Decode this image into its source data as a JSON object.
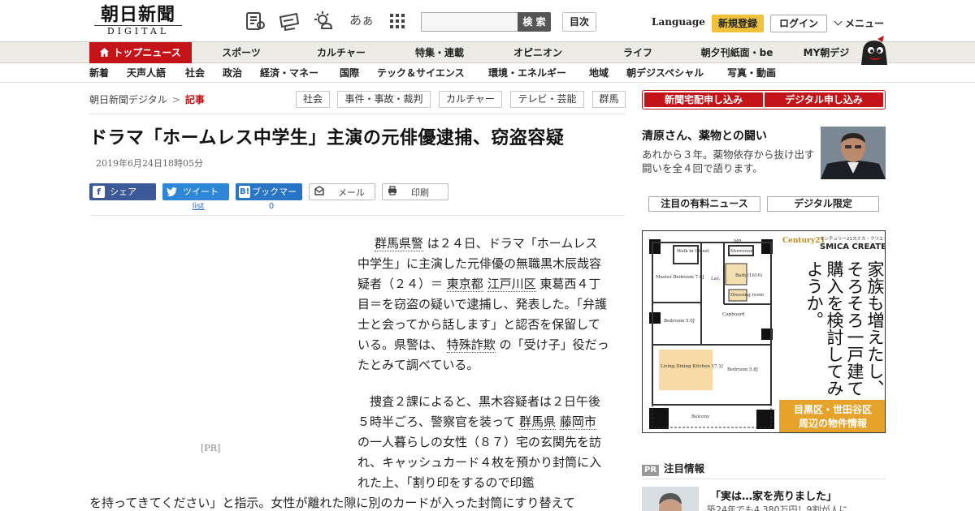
{
  "header": {
    "logo_main": "朝日新聞",
    "logo_sub": "DIGITAL",
    "search_button": "検 索",
    "search_placeholder": "",
    "toc_button": "目次",
    "language": "Language",
    "register_button": "新規登録",
    "login_button": "ログイン",
    "menu_button": "メニュー",
    "icons": [
      "newspaper-icon",
      "coupon-icon",
      "weather-icon",
      "font-size-icon",
      "grid-menu-icon"
    ],
    "font_size_glyph": "あぁ"
  },
  "nav_primary": [
    "トップニュース",
    "スポーツ",
    "カルチャー",
    "特集・連載",
    "オピニオン",
    "ライフ",
    "朝夕刊紙面・be",
    "MY朝デジ"
  ],
  "nav_secondary": [
    "新着",
    "天声人語",
    "社会",
    "政治",
    "経済・マネー",
    "国際",
    "テック＆サイエンス",
    "環境・エネルギー",
    "地域",
    "朝デジスペシャル",
    "写真・動画"
  ],
  "breadcrumb": {
    "home": "朝日新聞デジタル",
    "separator": ">",
    "current": "記事"
  },
  "tags": [
    "社会",
    "事件・事故・裁判",
    "カルチャー",
    "テレビ・芸能",
    "群馬"
  ],
  "article": {
    "headline": "ドラマ「ホームレス中学生」主演の元俳優逮捕、窃盗容疑",
    "date": "2019年6月24日18時05分",
    "share": {
      "facebook": "シェア",
      "twitter": "ツイート",
      "hatena": "ブックマーク",
      "mail": "メール",
      "print": "印刷",
      "twitter_count": "list",
      "hatena_count": "0"
    },
    "ad_label": "[PR]",
    "p1": [
      {
        "t": "群馬県警",
        "kw": true
      },
      {
        "t": " は２４日、ドラマ「ホームレス中学生」に主演した元俳優の無職黒木辰哉容疑者（２４）＝ ",
        "kw": false
      },
      {
        "t": "東京都",
        "kw": true
      },
      {
        "t": " ",
        "kw": false
      },
      {
        "t": "江戸川区",
        "kw": true
      },
      {
        "t": " 東葛西４丁目＝を窃盗の疑いで逮捕し、発表した。「弁護士と会ってから話します」と認否を保留している。県警は、 ",
        "kw": false
      },
      {
        "t": "特殊詐欺",
        "kw": true
      },
      {
        "t": " の「受け子」役だったとみて調べている。",
        "kw": false
      }
    ],
    "p2": [
      {
        "t": "捜査２課によると、黒木容疑者は２日午後５時半ごろ、警察官を装って ",
        "kw": false
      },
      {
        "t": "群馬県",
        "kw": true
      },
      {
        "t": " ",
        "kw": false
      },
      {
        "t": "藤岡市",
        "kw": true
      },
      {
        "t": " の一人暮らしの女性（８７）宅の玄関先を訪れ、キャッシュカード４枚を預かり封筒に入れた上、「割り印をするので印鑑",
        "kw": false
      }
    ],
    "p3": "を持ってきてください」と指示。女性が離れた隙に別のカードが入った封筒にすり替えて"
  },
  "sidebar": {
    "subscribe_paper": "新聞宅配申し込み",
    "subscribe_digital": "デジタル申し込み",
    "feature_title": "清原さん、薬物との闘い",
    "feature_desc": "あれから３年。薬物依存から抜け出す闘いを全４回で語ります。",
    "paid_news_button": "注目の有料ニュース",
    "digital_only_button": "デジタル限定",
    "ad": {
      "brand": "Century21",
      "brand_company": "センチュリー21スミカ・クリエイト",
      "brand_name": "SMICA CREATE",
      "copy": "家族も増えたし、そろそろ一戸建て購入を検討してみようか。",
      "cta_line1": "目黒区・世田谷区",
      "cta_line2": "周辺の物件情報",
      "rooms": [
        "Walk in Closet",
        "Storeroom",
        "Master Bedroom 7.0J",
        "Bath (1616)",
        "Lav.",
        "Dressing room",
        "Cupboard",
        "Bedroom 5.0J",
        "Living Dining Kitchen 17.1J",
        "Bedroom 5.8J",
        "Balcony",
        "MB"
      ]
    },
    "pr_badge": "PR",
    "pr_heading": "注目情報",
    "pr_item_title": "「実は…家を売りました」",
    "pr_item_sub": "築24年でも4,380万円！9割が人に"
  }
}
